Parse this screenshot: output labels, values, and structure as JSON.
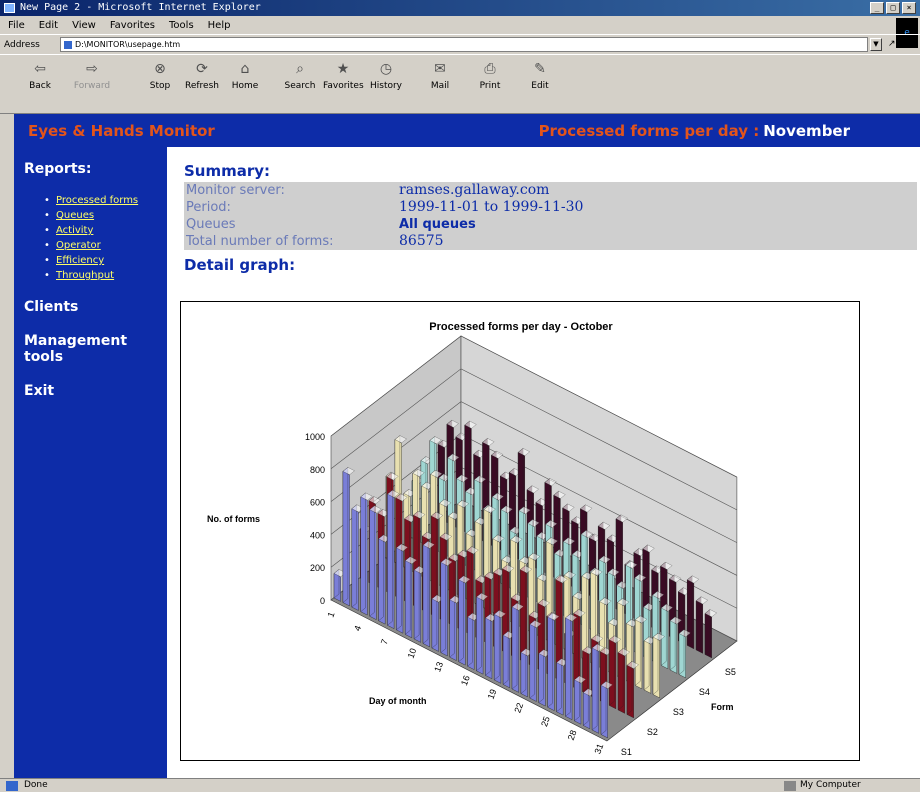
{
  "window": {
    "title": "New Page 2 - Microsoft Internet Explorer"
  },
  "menu": [
    "File",
    "Edit",
    "View",
    "Favorites",
    "Tools",
    "Help"
  ],
  "address": {
    "label": "Address",
    "value": "D:\\MONITOR\\usepage.htm",
    "go": "Go"
  },
  "toolbar": [
    {
      "label": "Back",
      "icon": "back-arrow-icon"
    },
    {
      "label": "Forward",
      "icon": "forward-arrow-icon"
    },
    {
      "label": "Stop",
      "icon": "stop-icon"
    },
    {
      "label": "Refresh",
      "icon": "refresh-icon"
    },
    {
      "label": "Home",
      "icon": "home-icon"
    },
    {
      "label": "Search",
      "icon": "search-icon"
    },
    {
      "label": "Favorites",
      "icon": "favorites-icon"
    },
    {
      "label": "History",
      "icon": "history-icon"
    },
    {
      "label": "Mail",
      "icon": "mail-icon"
    },
    {
      "label": "Print",
      "icon": "print-icon"
    },
    {
      "label": "Edit",
      "icon": "edit-icon"
    }
  ],
  "banner": {
    "app": "Eyes & Hands Monitor",
    "section": "Processed forms per day :",
    "month": "November"
  },
  "sidebar": {
    "reports_heading": "Reports:",
    "reports": [
      "Processed forms",
      "Queues",
      "Activity",
      "Operator",
      "Efficiency",
      "Throughput"
    ],
    "links": [
      "Clients",
      "Management tools",
      "Exit"
    ]
  },
  "summary": {
    "heading": "Summary:",
    "rows": [
      {
        "label": "Monitor server:",
        "value": "ramses.gallaway.com"
      },
      {
        "label": "Period:",
        "value": "1999-11-01 to 1999-11-30"
      },
      {
        "label": "Queues",
        "value": "All queues"
      },
      {
        "label": "Total number of forms:",
        "value": "86575"
      }
    ]
  },
  "detail_heading": "Detail graph:",
  "chart_data": {
    "type": "bar",
    "title": "Processed forms per day - October",
    "ylabel": "No. of forms",
    "xlabel": "Day of month",
    "zlabel": "Form",
    "ylim": [
      0,
      1000
    ],
    "yticks": [
      0,
      200,
      400,
      600,
      800,
      1000
    ],
    "xticks": [
      "1",
      "4",
      "7",
      "10",
      "13",
      "16",
      "19",
      "22",
      "25",
      "28",
      "31"
    ],
    "series": [
      {
        "name": "S1",
        "color": "#7a7ed8",
        "values": [
          150,
          800,
          600,
          700,
          650,
          500,
          800,
          500,
          450,
          420,
          600,
          300,
          550,
          350,
          500,
          300,
          450,
          350,
          400,
          300,
          500,
          250,
          450,
          300,
          550,
          300,
          600,
          250,
          200,
          500,
          300
        ]
      },
      {
        "name": "S2",
        "color": "#7d0f1e",
        "values": [
          300,
          500,
          450,
          700,
          600,
          500,
          550,
          450,
          600,
          500,
          400,
          450,
          500,
          350,
          400,
          450,
          500,
          350,
          550,
          300,
          400,
          350,
          600,
          300,
          450,
          250,
          350,
          300,
          400,
          350,
          300
        ]
      },
      {
        "name": "S3",
        "color": "#e8e0b0",
        "values": [
          500,
          750,
          450,
          600,
          550,
          650,
          500,
          450,
          550,
          400,
          500,
          600,
          450,
          350,
          500,
          400,
          450,
          350,
          600,
          400,
          450,
          350,
          500,
          550,
          400,
          300,
          450,
          350,
          400,
          300,
          350
        ]
      },
      {
        "name": "S4",
        "color": "#9fd6d2",
        "values": [
          350,
          500,
          650,
          450,
          600,
          500,
          450,
          550,
          400,
          500,
          450,
          350,
          500,
          450,
          400,
          500,
          350,
          450,
          400,
          550,
          350,
          450,
          400,
          350,
          500,
          450,
          300,
          400,
          350,
          300,
          250
        ]
      },
      {
        "name": "S5",
        "color": "#3a0b24",
        "values": [
          450,
          600,
          550,
          650,
          500,
          600,
          550,
          450,
          500,
          650,
          450,
          400,
          550,
          500,
          450,
          400,
          500,
          350,
          450,
          400,
          550,
          300,
          400,
          450,
          350,
          400,
          350,
          300,
          400,
          300,
          250
        ]
      }
    ],
    "grid": true,
    "view": "3d-column"
  },
  "status": {
    "left": "Done",
    "right": "My Computer"
  }
}
